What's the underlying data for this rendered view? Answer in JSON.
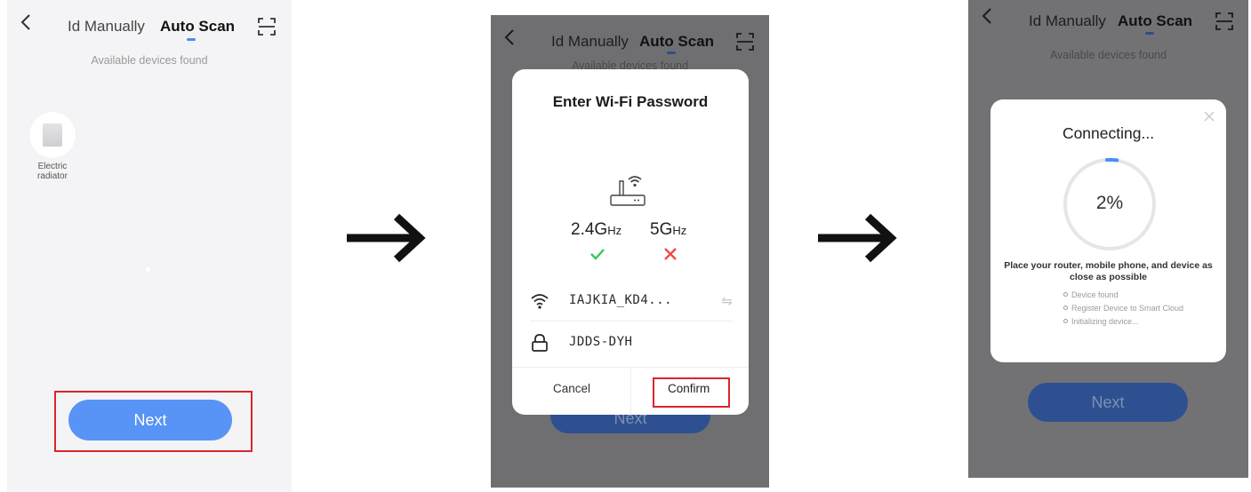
{
  "colors": {
    "accent": "#4a8ef5",
    "next_button": "#5794f6",
    "next_button_dimmed": "#2f5090",
    "highlight": "#d9262c",
    "check_green": "#2ecb52",
    "cross_red": "#ee4c49",
    "overlay": "#6f6f72"
  },
  "nav": {
    "tab_manual": "Id Manually",
    "tab_auto": "Auto Scan",
    "back_icon": "chevron-left-icon",
    "scan_icon": "scan-frame-icon"
  },
  "screen1": {
    "subtitle": "Available devices found",
    "device": {
      "name_line1": "Electric",
      "name_line2": "radiator",
      "icon": "radiator-icon"
    },
    "next_label": "Next"
  },
  "screen2": {
    "subtitle": "Available devices found",
    "dialog": {
      "title": "Enter Wi-Fi Password",
      "router_icon": "router-wifi-icon",
      "band_24": "2.4",
      "band_5": "5",
      "band_unit": "Hz",
      "band_unit_prefix": "G",
      "ssid": "IAJKIA_KD4...",
      "password": "JDDS-DYH",
      "cancel_label": "Cancel",
      "confirm_label": "Confirm"
    },
    "next_label": "Next"
  },
  "screen3": {
    "subtitle": "Available devices found",
    "card": {
      "title": "Connecting...",
      "percent_text": "2%",
      "progress": 0.02,
      "hint": "Place your router, mobile phone, and device as close as possible",
      "steps": [
        "Device found",
        "Register Device to Smart Cloud",
        "Initializing device..."
      ]
    },
    "next_label": "Next"
  }
}
